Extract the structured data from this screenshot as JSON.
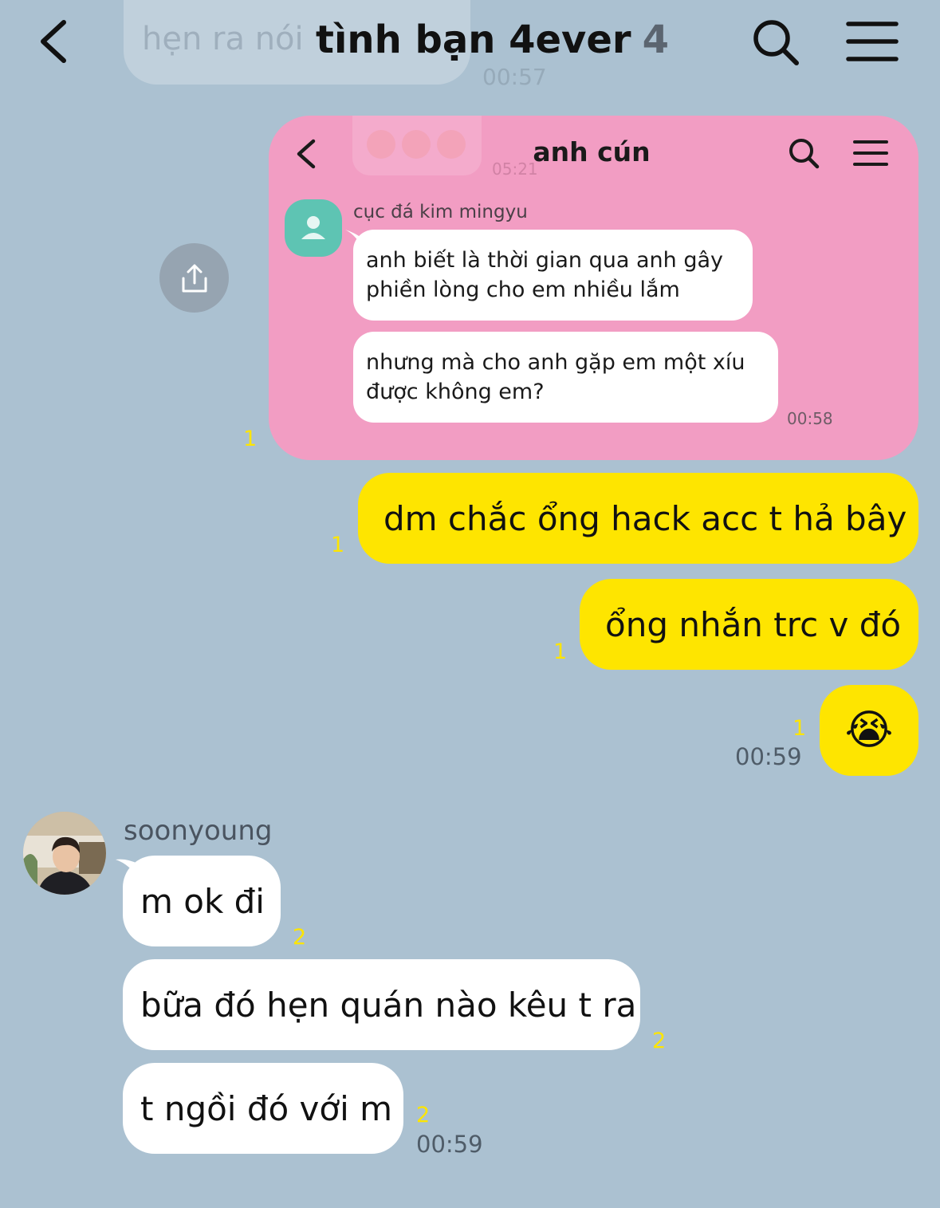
{
  "header": {
    "title": "tình bạn 4ever",
    "member_count": "4"
  },
  "faded_previous": {
    "text": "hẹn ra nói",
    "time": "00:57"
  },
  "shared_screenshot": {
    "faded_time": "05:21",
    "title": "anh cún",
    "sender": "cục đá kim mingyu",
    "messages": [
      "anh biết là thời gian qua anh gây phiền lòng cho em nhiều lắm",
      "nhưng mà cho anh gặp em một xíu được không em?"
    ],
    "time": "00:58",
    "read_count": "1"
  },
  "outgoing": [
    {
      "text": "dm chắc ổng hack acc t hả bây",
      "read_count": "1"
    },
    {
      "text": "ổng nhắn trc v đó",
      "read_count": "1"
    },
    {
      "text": "😭",
      "read_count": "1",
      "time": "00:59"
    }
  ],
  "incoming": {
    "sender": "soonyoung",
    "messages": [
      {
        "text": "m ok đi",
        "read_count": "2"
      },
      {
        "text": "bữa đó hẹn quán nào kêu t ra",
        "read_count": "2"
      },
      {
        "text": "t ngồi đó với m",
        "read_count": "2",
        "time": "00:59"
      }
    ]
  },
  "colors": {
    "background": "#abc1d1",
    "outgoing_bubble": "#fee500",
    "incoming_bubble": "#ffffff",
    "read_count": "#fde500",
    "screenshot_bg": "#f29dc3"
  },
  "icons": [
    "back-icon",
    "search-icon",
    "menu-icon",
    "share-icon",
    "person-icon"
  ]
}
